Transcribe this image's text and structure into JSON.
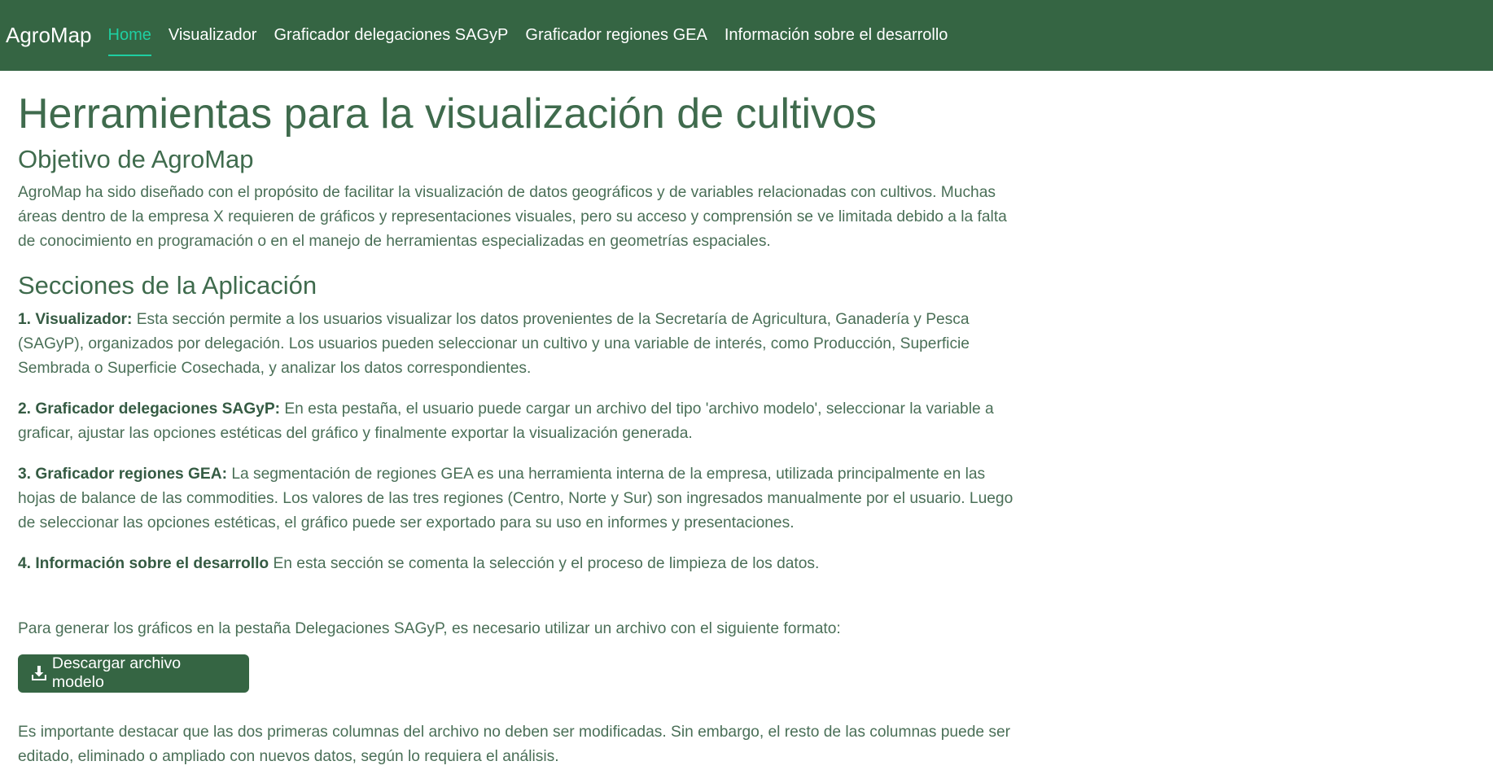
{
  "navbar": {
    "brand": "AgroMap",
    "links": [
      {
        "label": "Home"
      },
      {
        "label": "Visualizador"
      },
      {
        "label": "Graficador delegaciones SAGyP"
      },
      {
        "label": "Graficador regiones GEA"
      },
      {
        "label": "Información sobre el desarrollo"
      }
    ]
  },
  "main": {
    "title": "Herramientas para la visualización de cultivos",
    "objetivo": {
      "heading": "Objetivo de AgroMap",
      "text": "AgroMap ha sido diseñado con el propósito de facilitar la visualización de datos geográficos y de variables relacionadas con cultivos. Muchas áreas dentro de la empresa X requieren de gráficos y representaciones visuales, pero su acceso y comprensión se ve limitada debido a la falta de conocimiento en programación o en el manejo de herramientas especializadas en geometrías espaciales."
    },
    "secciones": {
      "heading": "Secciones de la Aplicación",
      "items": [
        {
          "label": "1. Visualizador:",
          "text": " Esta sección permite a los usuarios visualizar los datos provenientes de la Secretaría de Agricultura, Ganadería y Pesca (SAGyP), organizados por delegación. Los usuarios pueden seleccionar un cultivo y una variable de interés, como Producción, Superficie Sembrada o Superficie Cosechada, y analizar los datos correspondientes."
        },
        {
          "label": "2. Graficador delegaciones SAGyP:",
          "text": " En esta pestaña, el usuario puede cargar un archivo del tipo 'archivo modelo', seleccionar la variable a graficar, ajustar las opciones estéticas del gráfico y finalmente exportar la visualización generada."
        },
        {
          "label": "3. Graficador regiones GEA:",
          "text": " La segmentación de regiones GEA es una herramienta interna de la empresa, utilizada principalmente en las hojas de balance de las commodities. Los valores de las tres regiones (Centro, Norte y Sur) son ingresados manualmente por el usuario. Luego de seleccionar las opciones estéticas, el gráfico puede ser exportado para su uso en informes y presentaciones."
        },
        {
          "label": "4. Información sobre el desarrollo",
          "text": " En esta sección se comenta la selección y el proceso de limpieza de los datos."
        }
      ]
    },
    "formato_text": "Para generar los gráficos en la pestaña Delegaciones SAGyP, es necesario utilizar un archivo con el siguiente formato:",
    "download_button": {
      "icon": "download-icon",
      "label": "Descargar archivo modelo"
    },
    "nota_text": "Es importante destacar que las dos primeras columnas del archivo no deben ser modificadas. Sin embargo, el resto de las columnas puede ser editado, eliminado o ampliado con nuevos datos, según lo requiera el análisis."
  },
  "colors": {
    "navbar_bg": "#356543",
    "active_link": "#1ecfa2",
    "heading": "#3f6b4d",
    "text": "#4a6f57"
  }
}
